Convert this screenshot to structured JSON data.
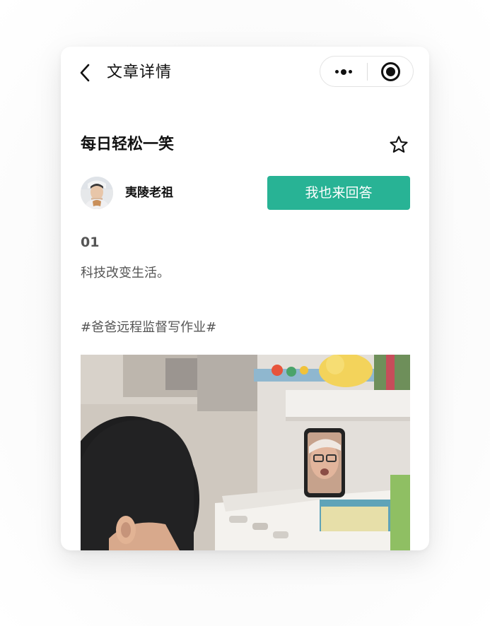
{
  "navbar": {
    "title": "文章详情",
    "back_icon": "chevron-left-icon",
    "more_icon": "more-dots-icon",
    "close_icon": "target-close-icon"
  },
  "article": {
    "title": "每日轻松一笑",
    "favorite_icon": "star-outline-icon",
    "author": {
      "name": "夷陵老祖",
      "avatar_icon": "avatar-photo"
    },
    "answer_button_label": "我也来回答",
    "section_number": "01",
    "paragraph": "科技改变生活。",
    "hashtag": "#爸爸远程监督写作业#",
    "video_icon": "video-frame-photo"
  },
  "colors": {
    "accent": "#28b395",
    "text_primary": "#111111",
    "text_secondary": "#555555",
    "card_bg": "#ffffff"
  }
}
